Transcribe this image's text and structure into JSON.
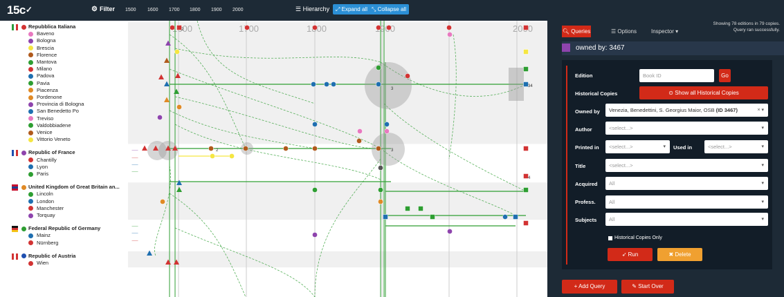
{
  "toolbar": {
    "logo": "15c",
    "filter_label": "Filter",
    "years": [
      "1500",
      "1600",
      "1700",
      "1800",
      "1900",
      "2000"
    ],
    "hierarchy_label": "Hierarchy",
    "expand_all": "Expand all",
    "collapse_all": "Collapse all"
  },
  "timeline": {
    "year_labels": [
      "1600",
      "1700",
      "1800",
      "1900",
      "2000"
    ],
    "point_counts": [
      "2",
      "3",
      "2",
      "34",
      "3",
      "4"
    ]
  },
  "tree": {
    "countries": [
      {
        "name": "Repubblica Italiana",
        "color": "#d23333",
        "flag": [
          "#2b9b3b",
          "#ffffff",
          "#d23333"
        ],
        "places": [
          {
            "name": "Baveno",
            "color": "#e879c0"
          },
          {
            "name": "Bologna",
            "color": "#8e44ad"
          },
          {
            "name": "Brescia",
            "color": "#f5e642"
          },
          {
            "name": "Florence",
            "color": "#b05a1c"
          },
          {
            "name": "Mantova",
            "color": "#2e9e32"
          },
          {
            "name": "Milano",
            "color": "#d23333"
          },
          {
            "name": "Padova",
            "color": "#1f6fb0"
          },
          {
            "name": "Pavia",
            "color": "#2e9e32"
          },
          {
            "name": "Piacenza",
            "color": "#e08a26"
          },
          {
            "name": "Pordenone",
            "color": "#e08a26"
          },
          {
            "name": "Provincia di Bologna",
            "color": "#8e44ad"
          },
          {
            "name": "San Benedetto Po",
            "color": "#1f6fb0"
          },
          {
            "name": "Treviso",
            "color": "#e879c0"
          },
          {
            "name": "Valdobbiadene",
            "color": "#2e9e32"
          },
          {
            "name": "Venice",
            "color": "#b05a1c"
          },
          {
            "name": "Vittorio Veneto",
            "color": "#f5e642"
          }
        ]
      },
      {
        "name": "Republic of France",
        "color": "#8e44ad",
        "flag": [
          "#1f4fb0",
          "#ffffff",
          "#d23333"
        ],
        "places": [
          {
            "name": "Chantilly",
            "color": "#d23333"
          },
          {
            "name": "Lyon",
            "color": "#1f6fb0"
          },
          {
            "name": "Paris",
            "color": "#2e9e32"
          }
        ]
      },
      {
        "name": "United Kingdom of Great Britain an...",
        "color": "#e08a26",
        "flag": [
          "#c8102e",
          "#1f3f8f",
          "#c8102e"
        ],
        "places": [
          {
            "name": "Lincoln",
            "color": "#2e9e32"
          },
          {
            "name": "London",
            "color": "#1f6fb0"
          },
          {
            "name": "Manchester",
            "color": "#d23333"
          },
          {
            "name": "Torquay",
            "color": "#8e44ad"
          }
        ]
      },
      {
        "name": "Federal Republic of Germany",
        "color": "#2e9e32",
        "flag": [
          "#111111",
          "#d23333",
          "#f5c518"
        ],
        "places": [
          {
            "name": "Mainz",
            "color": "#1f6fb0"
          },
          {
            "name": "Nürnberg",
            "color": "#d23333"
          }
        ]
      },
      {
        "name": "Republic of Austria",
        "color": "#1f4fb0",
        "flag": [
          "#d23333",
          "#ffffff",
          "#d23333"
        ],
        "places": [
          {
            "name": "Wien",
            "color": "#d23333"
          }
        ]
      }
    ]
  },
  "panel": {
    "tab_queries": "Queries",
    "tab_options": "Options",
    "tab_inspector": "Inspector",
    "status_line1": "Showing 78 editions in 79 copies.",
    "status_line2": "Query ran successfully.",
    "owned_title": "owned by: 3467",
    "owned_color": "#8e44ad",
    "fields": {
      "edition_label": "Edition",
      "edition_placeholder": "Book ID",
      "go": "Go",
      "historical_label": "Historical Copies",
      "show_all_historical": "Show all Historical Copies",
      "owned_by_label": "Owned by",
      "owned_by_value": "Venezia, Benedettini, S. Georgius Maior, OSB ",
      "owned_by_id": "(ID 3467)",
      "author_label": "Author",
      "author_value": "<select...>",
      "printed_in_label": "Printed in",
      "printed_in_value": "<select...>",
      "used_in_label": "Used in",
      "used_in_value": "<select...>",
      "title_label": "Title",
      "title_value": "<select...>",
      "acquired_label": "Acquired",
      "acquired_value": "All",
      "profess_label": "Profess.",
      "profess_value": "All",
      "subjects_label": "Subjects",
      "subjects_value": "All",
      "historical_only": "Historical Copies Only",
      "run": "Run",
      "delete": "Delete"
    },
    "add_query": "Add Query",
    "start_over": "Start Over"
  }
}
